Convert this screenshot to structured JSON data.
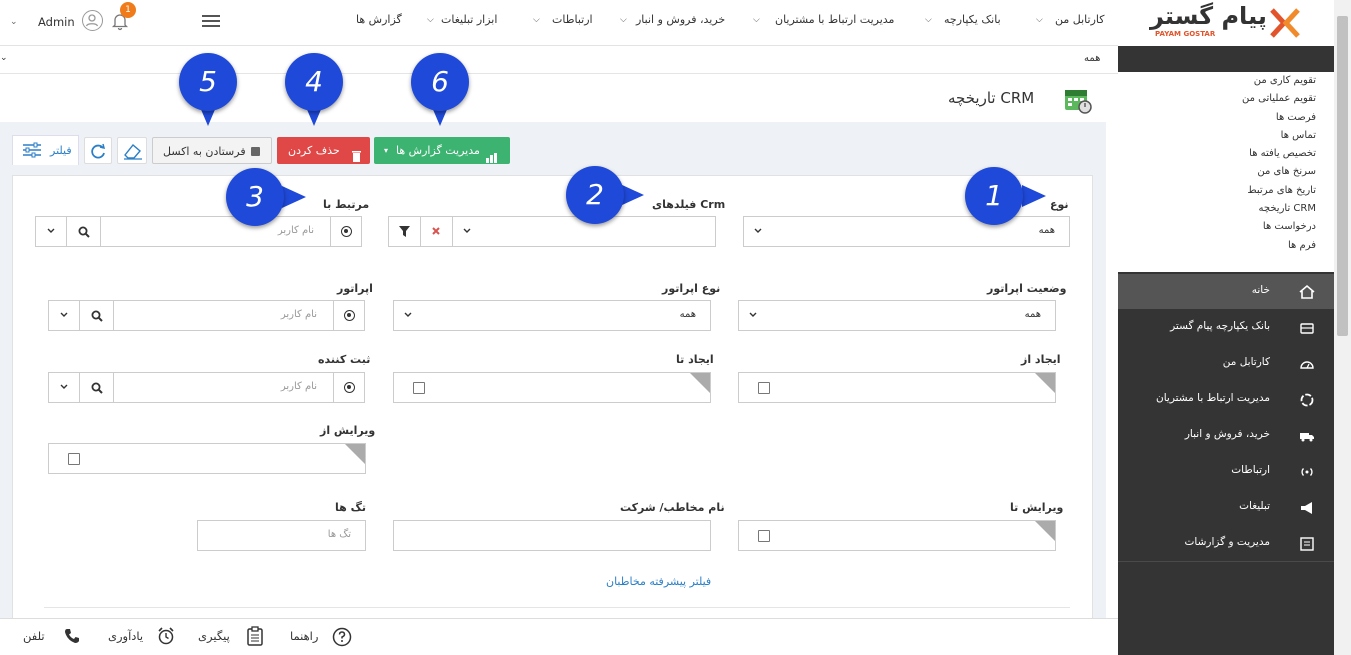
{
  "topbar": {
    "user": "Admin",
    "notification_count": "1",
    "nav": [
      "کارتابل من",
      "بانک یکپارچه",
      "مدیریت ارتباط با مشتریان",
      "خرید، فروش و انبار",
      "ارتباطات",
      "ابزار تبلیغات",
      "گزارش ها"
    ]
  },
  "logo": {
    "main": "پیام گستر",
    "sub": "PAYAM GOSTAR"
  },
  "breadcrumb": "همه",
  "page_title": "تاریخچه CRM",
  "toolbar": {
    "filter": "فیلتر",
    "export_excel": "فرستادن به اکسل",
    "delete": "حذف کردن",
    "report_manage": "مدیریت گزارش ها"
  },
  "quick_links": [
    "تقویم کاری من",
    "تقویم عملیاتی من",
    "فرصت ها",
    "تماس ها",
    "تخصیص یافته ها",
    "سرنخ های من",
    "تاریخ های مرتبط",
    "تاریخچه CRM",
    "درخواست ها",
    "فرم ها"
  ],
  "sidebar_menu": [
    "خانه",
    "بانک یکپارچه پیام گستر",
    "کارتابل من",
    "مدیریت ارتباط با مشتریان",
    "خرید، فروش و انبار",
    "ارتباطات",
    "تبلیغات",
    "مدیریت و گزارشات"
  ],
  "form": {
    "type_label": "نوع",
    "type_value": "همه",
    "crm_fields_label": "فیلدهای Crm",
    "related_label": "مرتبط با",
    "username_placeholder": "نام کاربر",
    "operator_status_label": "وضعیت اپراتور",
    "operator_status_value": "همه",
    "operator_type_label": "نوع اپراتور",
    "operator_type_value": "همه",
    "operator_label": "اپراتور",
    "created_from_label": "ایجاد از",
    "created_to_label": "ایجاد تا",
    "creator_label": "ثبت کننده",
    "edited_from_label": "ویرایش از",
    "edited_to_label": "ویرایش تا",
    "contact_label": "نام مخاطب/ شرکت",
    "tags_label": "تگ ها",
    "tags_placeholder": "تگ ها",
    "advanced_filter": "فیلتر پیشرفته مخاطبان"
  },
  "callouts": [
    "1",
    "2",
    "3",
    "4",
    "5",
    "6"
  ],
  "footer": {
    "phone": "تلفن",
    "reminder": "یادآوری",
    "followup": "پیگیری",
    "guide": "راهنما"
  },
  "colors": {
    "sidebar": "#343434",
    "delete": "#e04848",
    "report": "#3cb371",
    "callout": "#1f49d8",
    "link": "#2b7fc7"
  }
}
